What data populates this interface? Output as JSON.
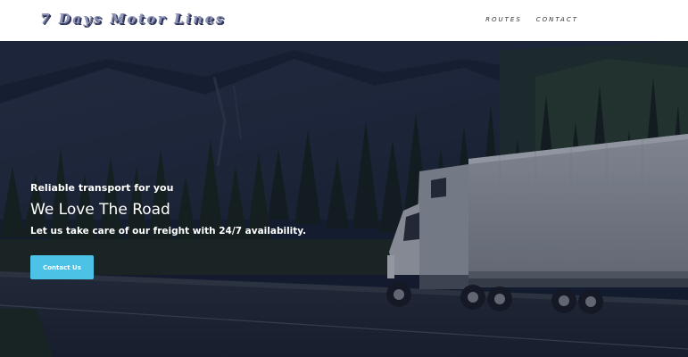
{
  "header": {
    "logo_text": "7 Days Motor Lines",
    "nav": [
      {
        "label": "ROUTES"
      },
      {
        "label": "CONTACT"
      }
    ]
  },
  "hero": {
    "tagline": "Reliable transport for you",
    "headline": "We Love The Road",
    "subline": "Let us take care of our freight with 24/7 availability.",
    "cta_label": "Contact Us"
  },
  "colors": {
    "accent": "#4cc2e6",
    "logo": "#8f95b8",
    "overlay": "#101a30"
  }
}
